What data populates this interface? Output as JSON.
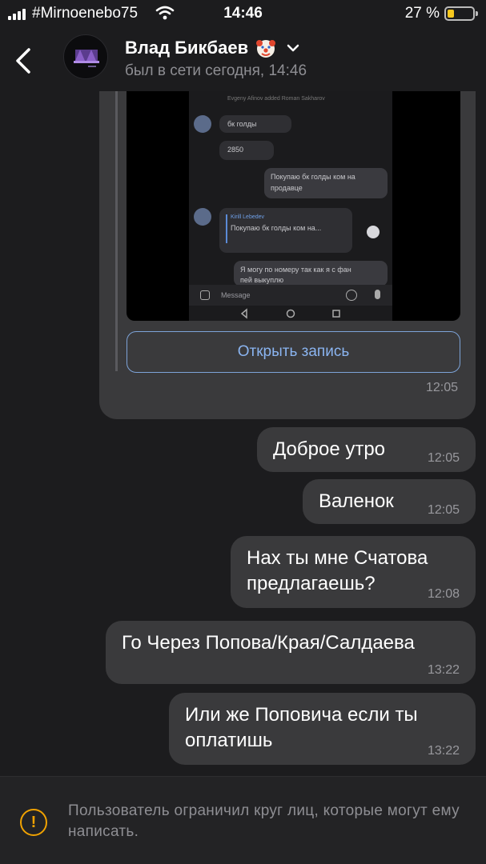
{
  "status_bar": {
    "carrier": "#Mirnoenebo75",
    "time": "14:46",
    "battery_percent": "27 %",
    "battery_level": 0.27
  },
  "header": {
    "contact_name": "Влад Бикбаев",
    "last_seen": "был в сети сегодня, 14:46",
    "icons": {
      "back": "chevron-left-icon",
      "badge": "clown-emoji-icon",
      "menu": "chevron-down-icon"
    }
  },
  "shared_post": {
    "video": {
      "header_text": "Evgeny Afinov added Roman Sakharov",
      "in_msg_1": "бк голды",
      "in_msg_2": "2850",
      "out_msg_1_line_1": "Покупаю бк голды ком на",
      "out_msg_1_line_2": "продавце",
      "reply_author": "Kirill Lebedev",
      "reply_quote": "Покупаю бк голды ком на...",
      "out_msg_2_line_1": "Я могу по номеру так как я с фан",
      "out_msg_2_line_2": "пей выкуплю",
      "input_placeholder": "Message"
    },
    "button_label": "Открыть запись",
    "time": "12:05"
  },
  "messages": [
    {
      "text": "Доброе утро",
      "time": "12:05"
    },
    {
      "text": "Валенок",
      "time": "12:05"
    },
    {
      "text_line_1": "Нах ты мне Счатова",
      "text_line_2": "предлагаешь?",
      "time": "12:08"
    },
    {
      "text": "Го Через Попова/Края/Салдаева",
      "time": "13:22"
    },
    {
      "text_line_1": "Или же Поповича если ты",
      "text_line_2": "оплатишь",
      "time": "13:22"
    }
  ],
  "footer": {
    "notice": "Пользователь ограничил круг лиц, которые могут ему написать.",
    "icon": "warning-icon",
    "icon_glyph": "!"
  },
  "colors": {
    "background": "#1c1c1e",
    "bubble": "#3a3a3c",
    "link": "#8ab4f0",
    "warning": "#f0a202"
  }
}
